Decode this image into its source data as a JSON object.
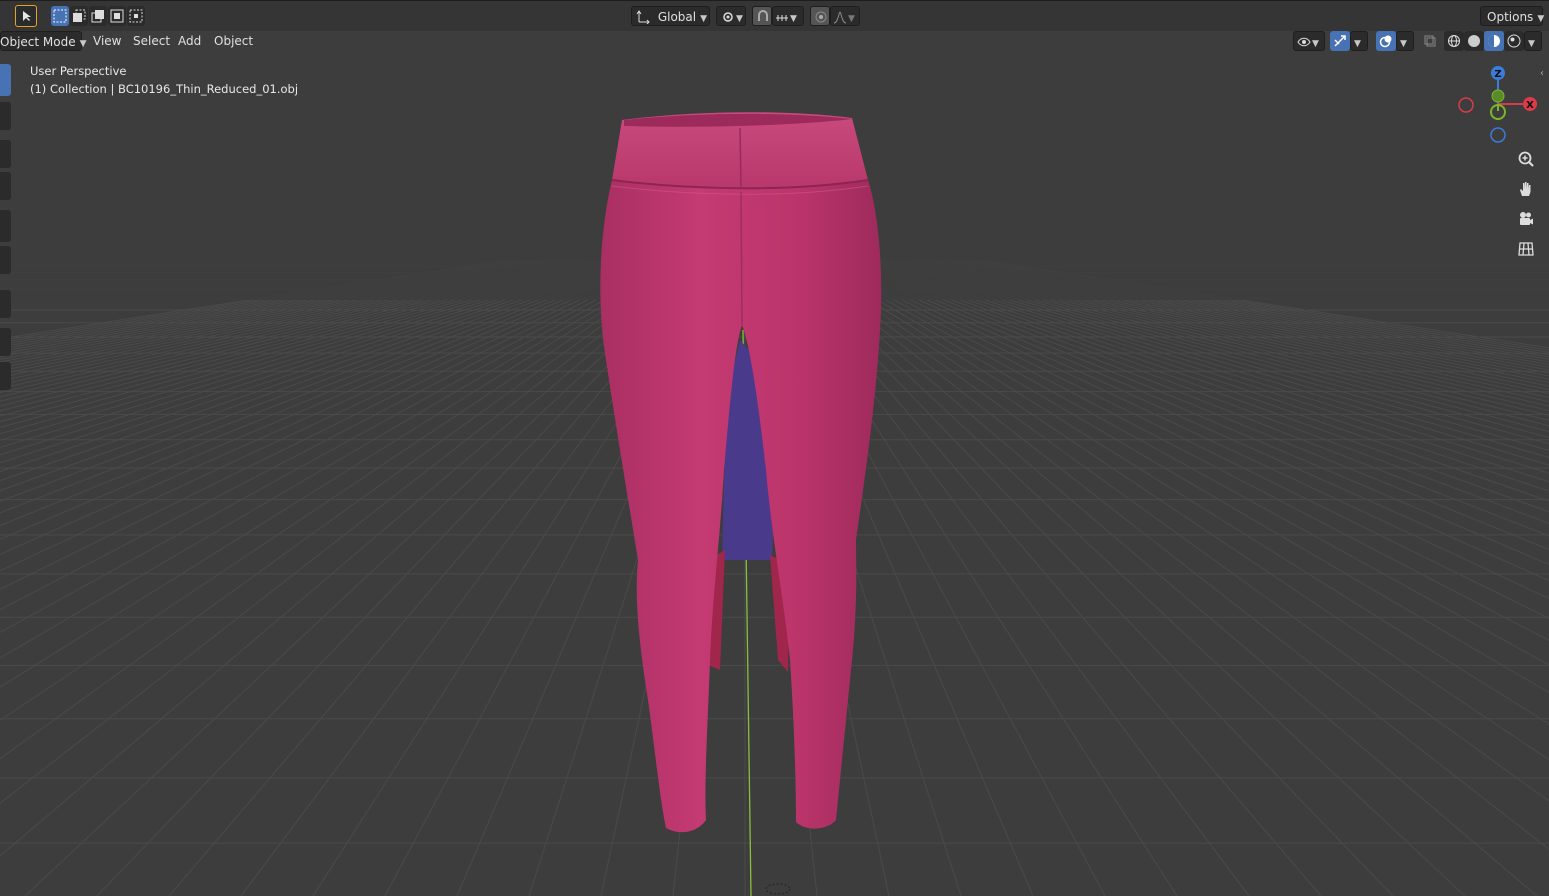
{
  "header": {
    "transform_orientation": "Global",
    "options_label": "Options"
  },
  "menu": {
    "mode_label": "Object Mode",
    "view_label": "View",
    "select_label": "Select",
    "add_label": "Add",
    "object_label": "Object"
  },
  "viewport": {
    "perspective_label": "User Perspective",
    "collection_label": "(1) Collection | BC10196_Thin_Reduced_01.obj"
  },
  "gizmo": {
    "z_label": "Z",
    "x_label": "X",
    "x_color": "#d93b4a",
    "y_color": "#7bb82a",
    "z_color": "#3b7bd9"
  },
  "icons": {
    "header_left": [
      "select-cursor-icon",
      "select-box-new-icon",
      "select-box-extend-icon",
      "select-box-subtract-icon",
      "select-box-intersect-icon"
    ],
    "header_center": [
      "transform-orientation-icon",
      "pivot-point-icon",
      "snap-icon",
      "snap-increment-icon",
      "proportional-editing-icon",
      "proportional-falloff-icon"
    ],
    "header_right": [
      "visibility-eye-icon",
      "gizmo-toggle-icon",
      "overlays-icon",
      "xray-icon",
      "wireframe-shading-icon",
      "solid-shading-icon",
      "material-preview-icon",
      "rendered-shading-icon"
    ],
    "navigation": [
      "zoom-icon",
      "pan-hand-icon",
      "camera-icon",
      "grid-orthographic-icon"
    ]
  },
  "colors": {
    "background": "#3d3d3d",
    "grid_line": "#4a4a4a",
    "object_pink": "#c43a72",
    "y_axis_line": "#8bbd3a",
    "active_blue": "#4772b3"
  }
}
